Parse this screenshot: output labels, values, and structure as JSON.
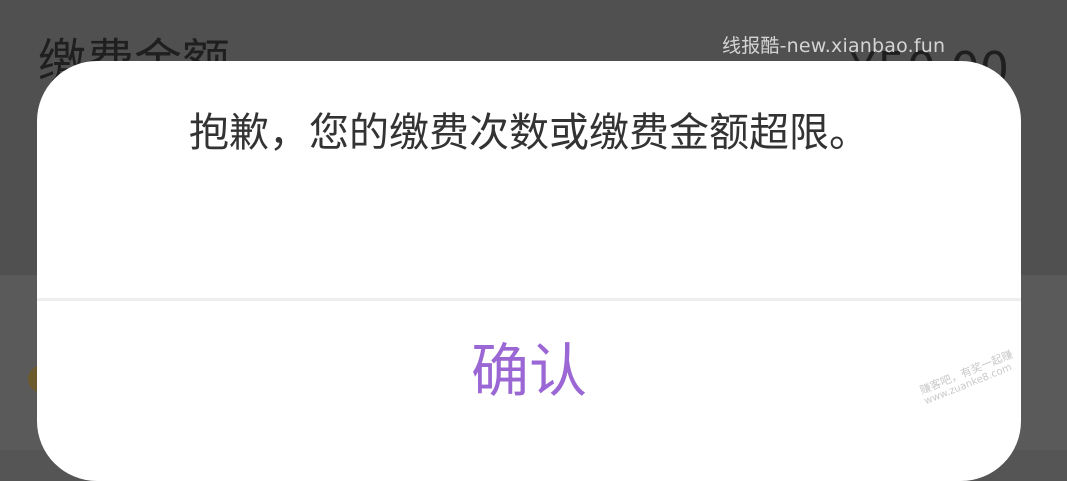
{
  "background_page": {
    "label": "缴费金额",
    "amount": "¥50.00"
  },
  "watermarks": {
    "top": "线报酷-new.xianbao.fun",
    "corner_line1": "赚客吧，有奖一起赚",
    "corner_line2": "www.zuanke8.com"
  },
  "dialog": {
    "message": "抱歉，您的缴费次数或缴费金额超限。",
    "confirm_label": "确认"
  },
  "colors": {
    "confirm": "#9b67d4",
    "overlay": "#555555",
    "dialog_bg": "#ffffff"
  }
}
